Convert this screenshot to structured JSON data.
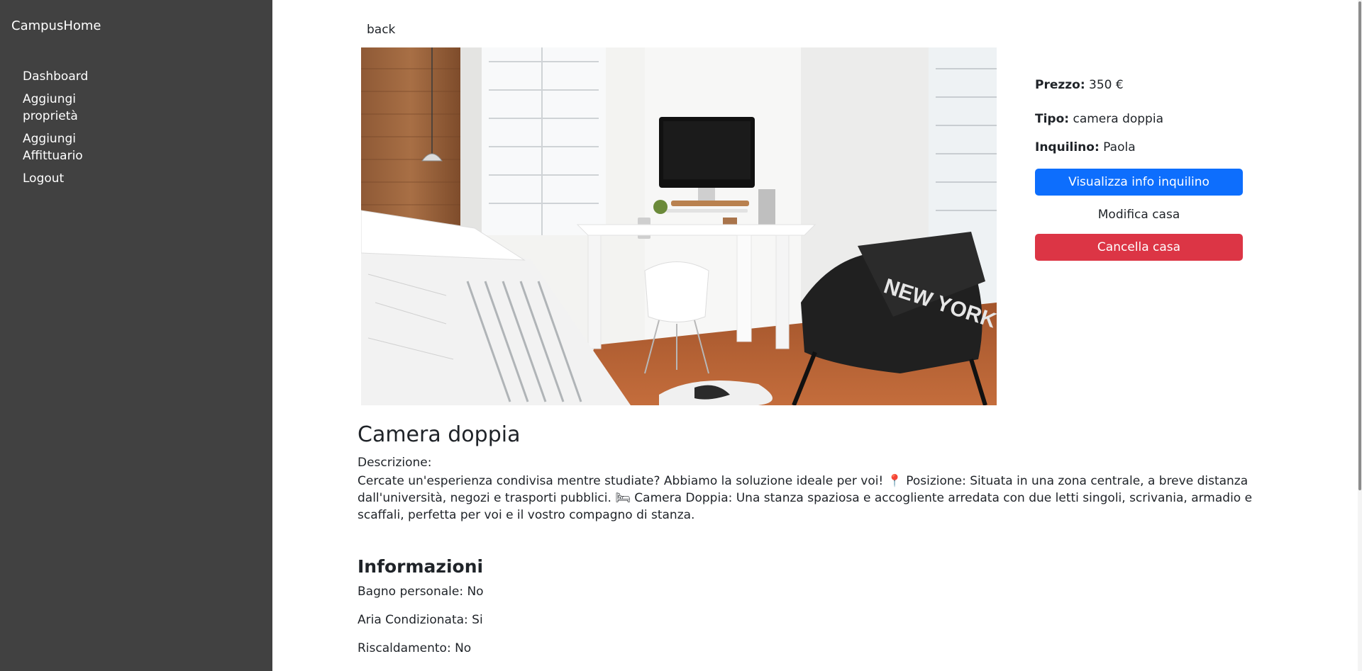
{
  "app": {
    "brand": "CampusHome"
  },
  "sidebar": {
    "items": [
      {
        "label": "Dashboard"
      },
      {
        "label": "Aggiungi proprietà"
      },
      {
        "label": "Aggiungi Affittuario"
      },
      {
        "label": "Logout"
      }
    ]
  },
  "main": {
    "back_label": "back",
    "details": {
      "price_label": "Prezzo:",
      "price_value": "350 €",
      "type_label": "Tipo:",
      "type_value": "camera doppia",
      "tenant_label": "Inquilino:",
      "tenant_value": "Paola"
    },
    "buttons": {
      "view_tenant": "Visualizza info inquilino",
      "edit": "Modifica casa",
      "delete": "Cancella casa"
    },
    "title": "Camera doppia",
    "description_label": "Descrizione:",
    "description": "Cercate un'esperienza condivisa mentre studiate? Abbiamo la soluzione ideale per voi! 📍 Posizione: Situata in una zona centrale, a breve distanza dall'università, negozi e trasporti pubblici. 🛏 Camera Doppia: Una stanza spaziosa e accogliente arredata con due letti singoli, scrivania, armadio e scaffali, perfetta per voi e il vostro compagno di stanza.",
    "info_title": "Informazioni",
    "features": [
      {
        "text": "Bagno personale: No"
      },
      {
        "text": "Aria Condizionata: Si"
      },
      {
        "text": "Riscaldamento: No"
      }
    ],
    "photo_overlay_text": "NEW YORK"
  },
  "colors": {
    "sidebar": "#414141",
    "primary": "#0d6efd",
    "danger": "#dc3545"
  }
}
